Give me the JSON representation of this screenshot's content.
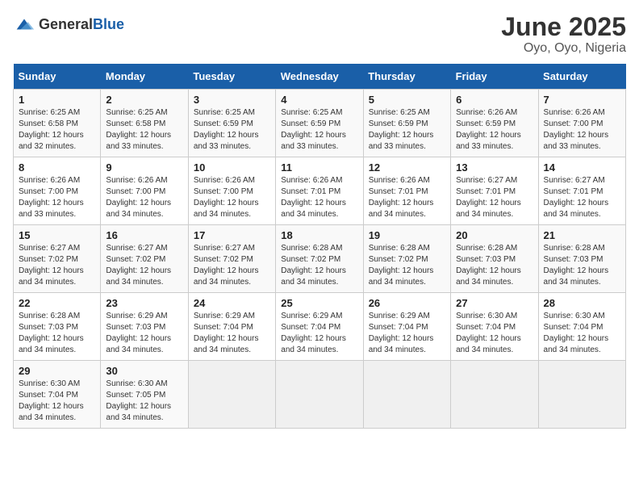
{
  "logo": {
    "general": "General",
    "blue": "Blue"
  },
  "title": "June 2025",
  "subtitle": "Oyo, Oyo, Nigeria",
  "days_of_week": [
    "Sunday",
    "Monday",
    "Tuesday",
    "Wednesday",
    "Thursday",
    "Friday",
    "Saturday"
  ],
  "weeks": [
    [
      {
        "day": "1",
        "sunrise": "6:25 AM",
        "sunset": "6:58 PM",
        "daylight": "12 hours and 32 minutes."
      },
      {
        "day": "2",
        "sunrise": "6:25 AM",
        "sunset": "6:58 PM",
        "daylight": "12 hours and 33 minutes."
      },
      {
        "day": "3",
        "sunrise": "6:25 AM",
        "sunset": "6:59 PM",
        "daylight": "12 hours and 33 minutes."
      },
      {
        "day": "4",
        "sunrise": "6:25 AM",
        "sunset": "6:59 PM",
        "daylight": "12 hours and 33 minutes."
      },
      {
        "day": "5",
        "sunrise": "6:25 AM",
        "sunset": "6:59 PM",
        "daylight": "12 hours and 33 minutes."
      },
      {
        "day": "6",
        "sunrise": "6:26 AM",
        "sunset": "6:59 PM",
        "daylight": "12 hours and 33 minutes."
      },
      {
        "day": "7",
        "sunrise": "6:26 AM",
        "sunset": "7:00 PM",
        "daylight": "12 hours and 33 minutes."
      }
    ],
    [
      {
        "day": "8",
        "sunrise": "6:26 AM",
        "sunset": "7:00 PM",
        "daylight": "12 hours and 33 minutes."
      },
      {
        "day": "9",
        "sunrise": "6:26 AM",
        "sunset": "7:00 PM",
        "daylight": "12 hours and 34 minutes."
      },
      {
        "day": "10",
        "sunrise": "6:26 AM",
        "sunset": "7:00 PM",
        "daylight": "12 hours and 34 minutes."
      },
      {
        "day": "11",
        "sunrise": "6:26 AM",
        "sunset": "7:01 PM",
        "daylight": "12 hours and 34 minutes."
      },
      {
        "day": "12",
        "sunrise": "6:26 AM",
        "sunset": "7:01 PM",
        "daylight": "12 hours and 34 minutes."
      },
      {
        "day": "13",
        "sunrise": "6:27 AM",
        "sunset": "7:01 PM",
        "daylight": "12 hours and 34 minutes."
      },
      {
        "day": "14",
        "sunrise": "6:27 AM",
        "sunset": "7:01 PM",
        "daylight": "12 hours and 34 minutes."
      }
    ],
    [
      {
        "day": "15",
        "sunrise": "6:27 AM",
        "sunset": "7:02 PM",
        "daylight": "12 hours and 34 minutes."
      },
      {
        "day": "16",
        "sunrise": "6:27 AM",
        "sunset": "7:02 PM",
        "daylight": "12 hours and 34 minutes."
      },
      {
        "day": "17",
        "sunrise": "6:27 AM",
        "sunset": "7:02 PM",
        "daylight": "12 hours and 34 minutes."
      },
      {
        "day": "18",
        "sunrise": "6:28 AM",
        "sunset": "7:02 PM",
        "daylight": "12 hours and 34 minutes."
      },
      {
        "day": "19",
        "sunrise": "6:28 AM",
        "sunset": "7:02 PM",
        "daylight": "12 hours and 34 minutes."
      },
      {
        "day": "20",
        "sunrise": "6:28 AM",
        "sunset": "7:03 PM",
        "daylight": "12 hours and 34 minutes."
      },
      {
        "day": "21",
        "sunrise": "6:28 AM",
        "sunset": "7:03 PM",
        "daylight": "12 hours and 34 minutes."
      }
    ],
    [
      {
        "day": "22",
        "sunrise": "6:28 AM",
        "sunset": "7:03 PM",
        "daylight": "12 hours and 34 minutes."
      },
      {
        "day": "23",
        "sunrise": "6:29 AM",
        "sunset": "7:03 PM",
        "daylight": "12 hours and 34 minutes."
      },
      {
        "day": "24",
        "sunrise": "6:29 AM",
        "sunset": "7:04 PM",
        "daylight": "12 hours and 34 minutes."
      },
      {
        "day": "25",
        "sunrise": "6:29 AM",
        "sunset": "7:04 PM",
        "daylight": "12 hours and 34 minutes."
      },
      {
        "day": "26",
        "sunrise": "6:29 AM",
        "sunset": "7:04 PM",
        "daylight": "12 hours and 34 minutes."
      },
      {
        "day": "27",
        "sunrise": "6:30 AM",
        "sunset": "7:04 PM",
        "daylight": "12 hours and 34 minutes."
      },
      {
        "day": "28",
        "sunrise": "6:30 AM",
        "sunset": "7:04 PM",
        "daylight": "12 hours and 34 minutes."
      }
    ],
    [
      {
        "day": "29",
        "sunrise": "6:30 AM",
        "sunset": "7:04 PM",
        "daylight": "12 hours and 34 minutes."
      },
      {
        "day": "30",
        "sunrise": "6:30 AM",
        "sunset": "7:05 PM",
        "daylight": "12 hours and 34 minutes."
      },
      {
        "day": "",
        "sunrise": "",
        "sunset": "",
        "daylight": ""
      },
      {
        "day": "",
        "sunrise": "",
        "sunset": "",
        "daylight": ""
      },
      {
        "day": "",
        "sunrise": "",
        "sunset": "",
        "daylight": ""
      },
      {
        "day": "",
        "sunrise": "",
        "sunset": "",
        "daylight": ""
      },
      {
        "day": "",
        "sunrise": "",
        "sunset": "",
        "daylight": ""
      }
    ]
  ]
}
